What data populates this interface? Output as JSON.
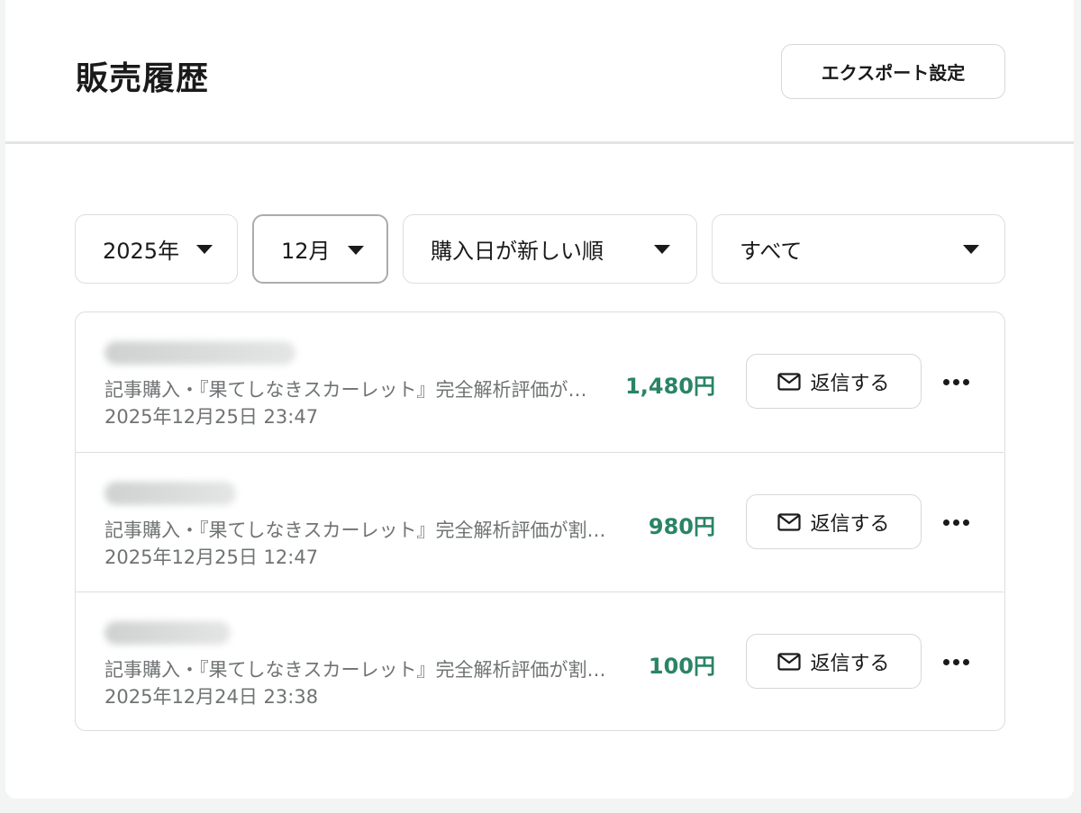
{
  "header": {
    "title": "販売履歴",
    "export_label": "エクスポート設定"
  },
  "filters": {
    "year": "2025年",
    "month": "12月",
    "sort": "購入日が新しい順",
    "type": "すべて"
  },
  "icons": {
    "dropdown": "caret-down-icon",
    "reply": "mail-icon",
    "more": "more-horizontal-icon"
  },
  "colors": {
    "price": "#2a8466",
    "border": "#dcdede"
  },
  "sales": [
    {
      "buyer": "",
      "description": "記事購入・『果てしなきスカーレット』完全解析評価が…",
      "date": "2025年12月25日 23:47",
      "price": "1,480円",
      "reply_label": "返信する"
    },
    {
      "buyer": "",
      "description": "記事購入・『果てしなきスカーレット』完全解析評価が割…",
      "date": "2025年12月25日 12:47",
      "price": "980円",
      "reply_label": "返信する"
    },
    {
      "buyer": "",
      "description": "記事購入・『果てしなきスカーレット』完全解析評価が割…",
      "date": "2025年12月24日 23:38",
      "price": "100円",
      "reply_label": "返信する"
    }
  ]
}
